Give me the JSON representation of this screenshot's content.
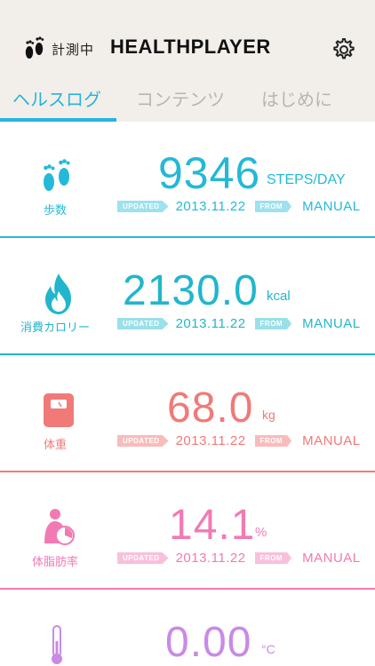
{
  "header": {
    "status_label": "計測中",
    "app_title": "HEALTHPLAYER"
  },
  "tabs": [
    {
      "label": "ヘルスログ"
    },
    {
      "label": "コンテンツ"
    },
    {
      "label": "はじめに"
    }
  ],
  "metrics": [
    {
      "label": "歩数",
      "value": "9346",
      "unit": "STEPS/DAY",
      "updated_tag": "UPDATED",
      "date": "2013.11.22",
      "from_tag": "FROM",
      "source": "MANUAL",
      "color": "#24b9d6"
    },
    {
      "label": "消費カロリー",
      "value": "2130.0",
      "unit": "kcal",
      "updated_tag": "UPDATED",
      "date": "2013.11.22",
      "from_tag": "FROM",
      "source": "MANUAL",
      "color": "#21b6cc"
    },
    {
      "label": "体重",
      "value": "68.0",
      "unit": "kg",
      "updated_tag": "UPDATED",
      "date": "2013.11.22",
      "from_tag": "FROM",
      "source": "MANUAL",
      "color": "#f07a78"
    },
    {
      "label": "体脂肪率",
      "value": "14.1",
      "unit": "%",
      "updated_tag": "UPDATED",
      "date": "2013.11.22",
      "from_tag": "FROM",
      "source": "MANUAL",
      "color": "#f27ab4"
    },
    {
      "value": "0.00",
      "unit": "°C",
      "color": "#c98ae6"
    }
  ],
  "colors": {
    "accent": "#28b4dc",
    "header_bg": "#f2efea"
  },
  "icons": {
    "status": "footprints-icon",
    "settings": "gear-icon",
    "steps": "footprints-icon",
    "calories": "flame-icon",
    "weight": "scale-icon",
    "body_fat": "body-fat-icon",
    "temperature": "thermometer-icon"
  }
}
